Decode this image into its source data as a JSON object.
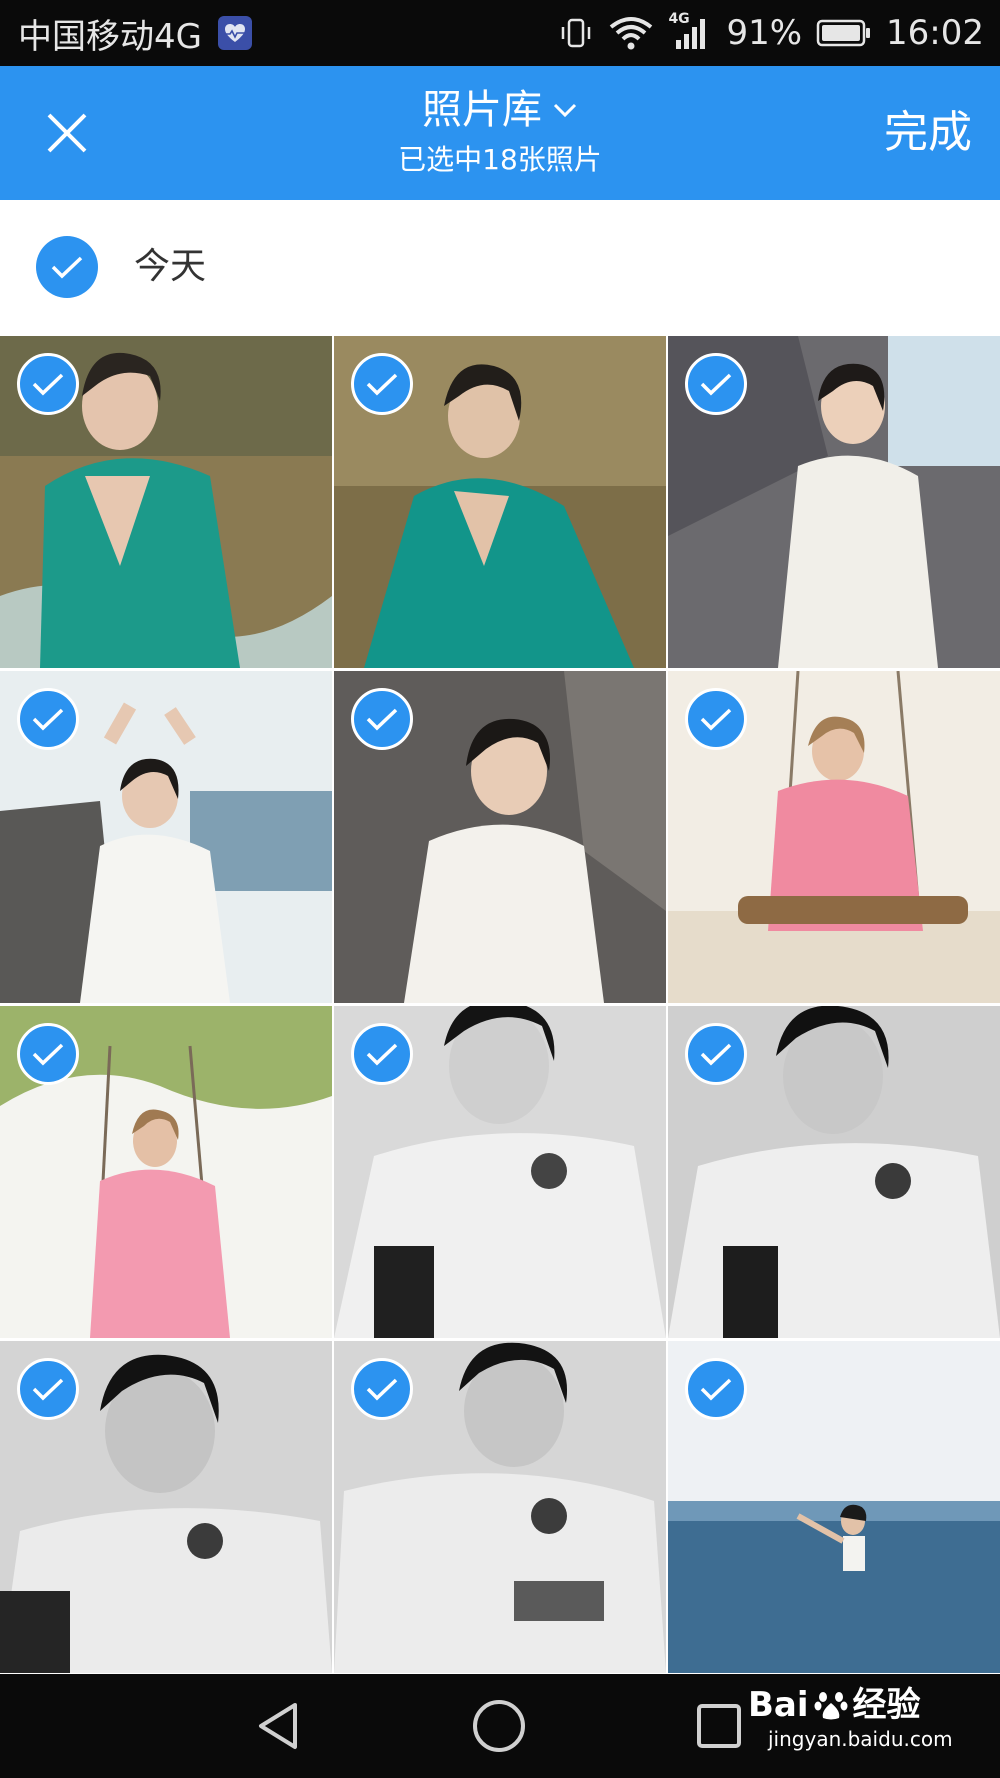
{
  "status_bar": {
    "carrier": "中国移动4G",
    "network_badge": "4G",
    "battery_percent": "91%",
    "time": "16:02",
    "icons": [
      "health-app-icon",
      "vibrate-icon",
      "wifi-icon",
      "signal-icon",
      "battery-icon"
    ]
  },
  "header": {
    "title": "照片库",
    "subtitle": "已选中18张照片",
    "done_label": "完成",
    "accent_color": "#2c93f0"
  },
  "section": {
    "date_label": "今天",
    "all_selected": true
  },
  "photos": [
    {
      "selected": true
    },
    {
      "selected": true
    },
    {
      "selected": true
    },
    {
      "selected": true
    },
    {
      "selected": true
    },
    {
      "selected": true
    },
    {
      "selected": true
    },
    {
      "selected": true
    },
    {
      "selected": true
    },
    {
      "selected": true
    },
    {
      "selected": true
    },
    {
      "selected": true
    }
  ],
  "watermark": {
    "brand_left": "Bai",
    "brand_right": "经验",
    "url": "jingyan.baidu.com"
  }
}
